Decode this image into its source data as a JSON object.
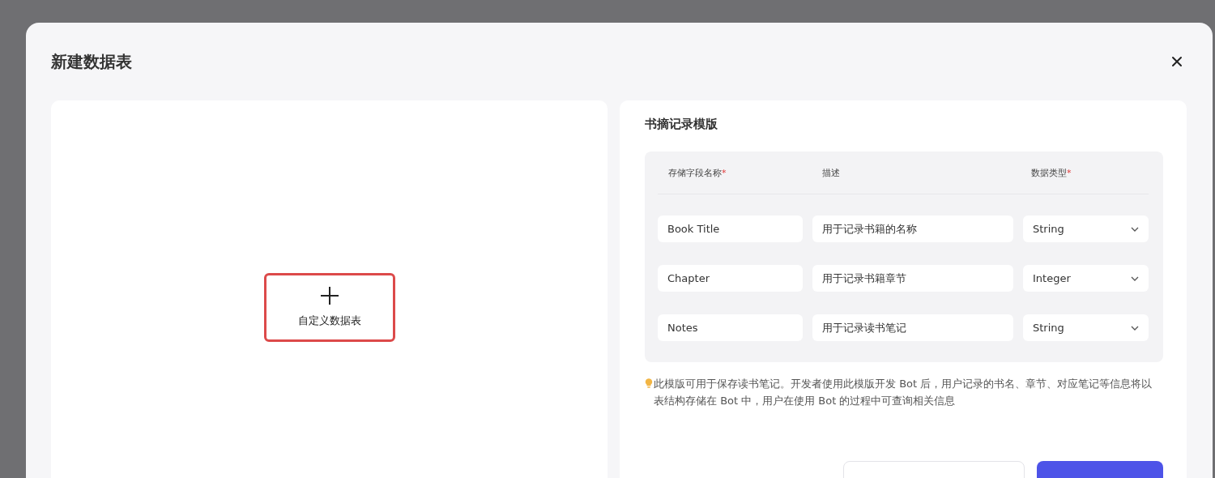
{
  "dialog": {
    "title": "新建数据表"
  },
  "custom_table_button": {
    "label": "自定义数据表",
    "highlighted": true
  },
  "template": {
    "title": "书摘记录模版",
    "columns": [
      {
        "label": "存储字段名称",
        "required_mark": "*"
      },
      {
        "label": "描述"
      },
      {
        "label": "数据类型",
        "required_mark": "*"
      }
    ],
    "rows": [
      {
        "name": "Book Title",
        "description": "用于记录书籍的名称",
        "type": "String"
      },
      {
        "name": "Chapter",
        "description": "用于记录书籍章节",
        "type": "Integer"
      },
      {
        "name": "Notes",
        "description": "用于记录读书笔记",
        "type": "String"
      }
    ],
    "note": "此模版可用于保存读书笔记。开发者使用此模版开发 Bot 后，用户记录的书名、章节、对应笔记等信息将以表结构存储在 Bot 中，用户在使用 Bot 的过程中可查询相关信息"
  }
}
